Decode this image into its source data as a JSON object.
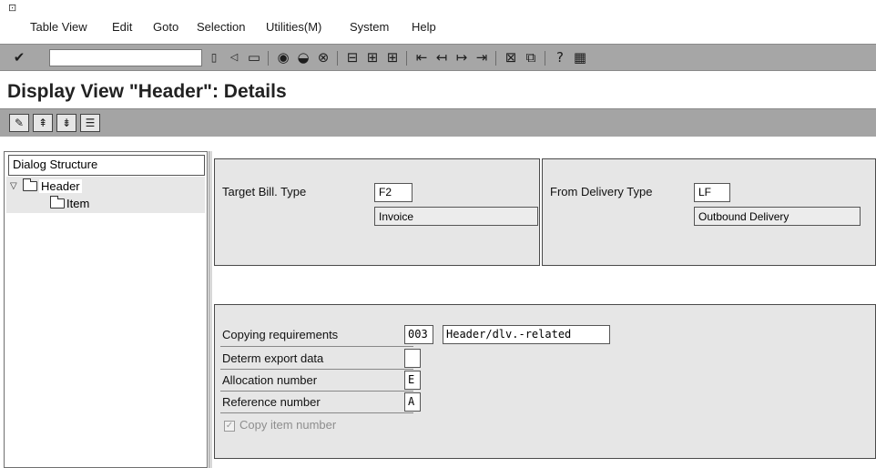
{
  "menubar": {
    "items": [
      "Table View",
      "Edit",
      "Goto",
      "Selection",
      "Utilities(M)",
      "System",
      "Help"
    ]
  },
  "toolbar": {
    "command_field_value": "",
    "icons": [
      "enter-icon",
      "dropdown-icon",
      "back-arrow-icon",
      "save-icon",
      "back-icon",
      "exit-icon",
      "cancel-icon",
      "print-icon",
      "find-icon",
      "find-next-icon",
      "first-page-icon",
      "previous-page-icon",
      "next-page-icon",
      "last-page-icon",
      "new-session-icon",
      "shortcut-icon",
      "help-icon",
      "layout-menu-icon"
    ]
  },
  "title": "Display View \"Header\": Details",
  "app_toolbar": {
    "icons": [
      "display-change-icon",
      "previous-entry-icon",
      "next-entry-icon",
      "variable-list-icon"
    ]
  },
  "dialog_structure": {
    "title": "Dialog Structure",
    "items": [
      {
        "label": "Header",
        "selected": true
      },
      {
        "label": "Item",
        "selected": false
      }
    ]
  },
  "header_group": {
    "target_bill_type_label": "Target Bill. Type",
    "target_bill_type_value": "F2",
    "target_bill_type_desc": "Invoice",
    "from_delivery_type_label": "From Delivery Type",
    "from_delivery_type_value": "LF",
    "from_delivery_type_desc": "Outbound Delivery"
  },
  "details_group": {
    "copying_requirements_label": "Copying requirements",
    "copying_requirements_value": "003",
    "copying_requirements_desc": "Header/dlv.-related",
    "export_data_label": "Determ export data",
    "export_data_value": "",
    "allocation_number_label": "Allocation number",
    "allocation_number_value": "E",
    "reference_number_label": "Reference number",
    "reference_number_value": "A",
    "copy_item_number_label": "Copy item number",
    "copy_item_number_checked": true
  }
}
